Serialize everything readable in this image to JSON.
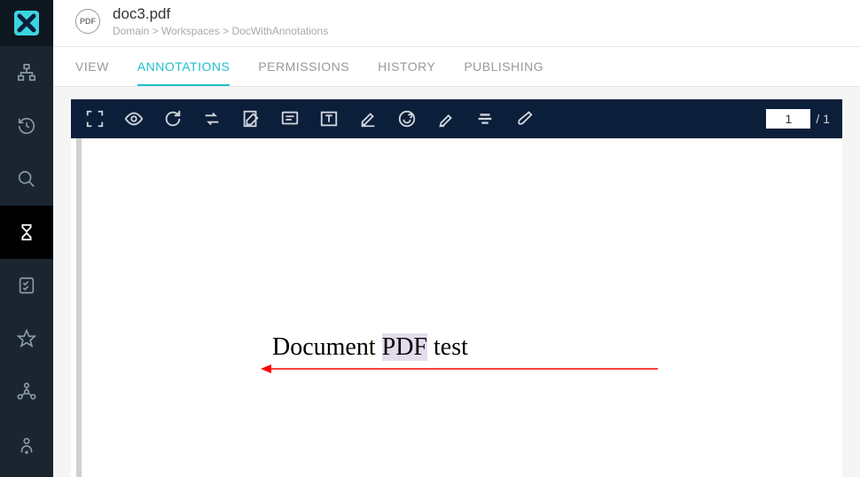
{
  "sidebar": {
    "items": [
      "hierarchy",
      "history",
      "search",
      "hourglass",
      "checklist",
      "star",
      "share",
      "user"
    ]
  },
  "header": {
    "icon_label": "PDF",
    "title": "doc3.pdf",
    "breadcrumb": "Domain > Workspaces > DocWithAnnotations"
  },
  "tabs": [
    {
      "label": "VIEW",
      "active": false
    },
    {
      "label": "ANNOTATIONS",
      "active": true
    },
    {
      "label": "PERMISSIONS",
      "active": false
    },
    {
      "label": "HISTORY",
      "active": false
    },
    {
      "label": "PUBLISHING",
      "active": false
    }
  ],
  "toolbar": {
    "page_current": "1",
    "page_total": "/ 1"
  },
  "document": {
    "text_before": "Document ",
    "text_highlight": "PDF",
    "text_after": " test"
  }
}
